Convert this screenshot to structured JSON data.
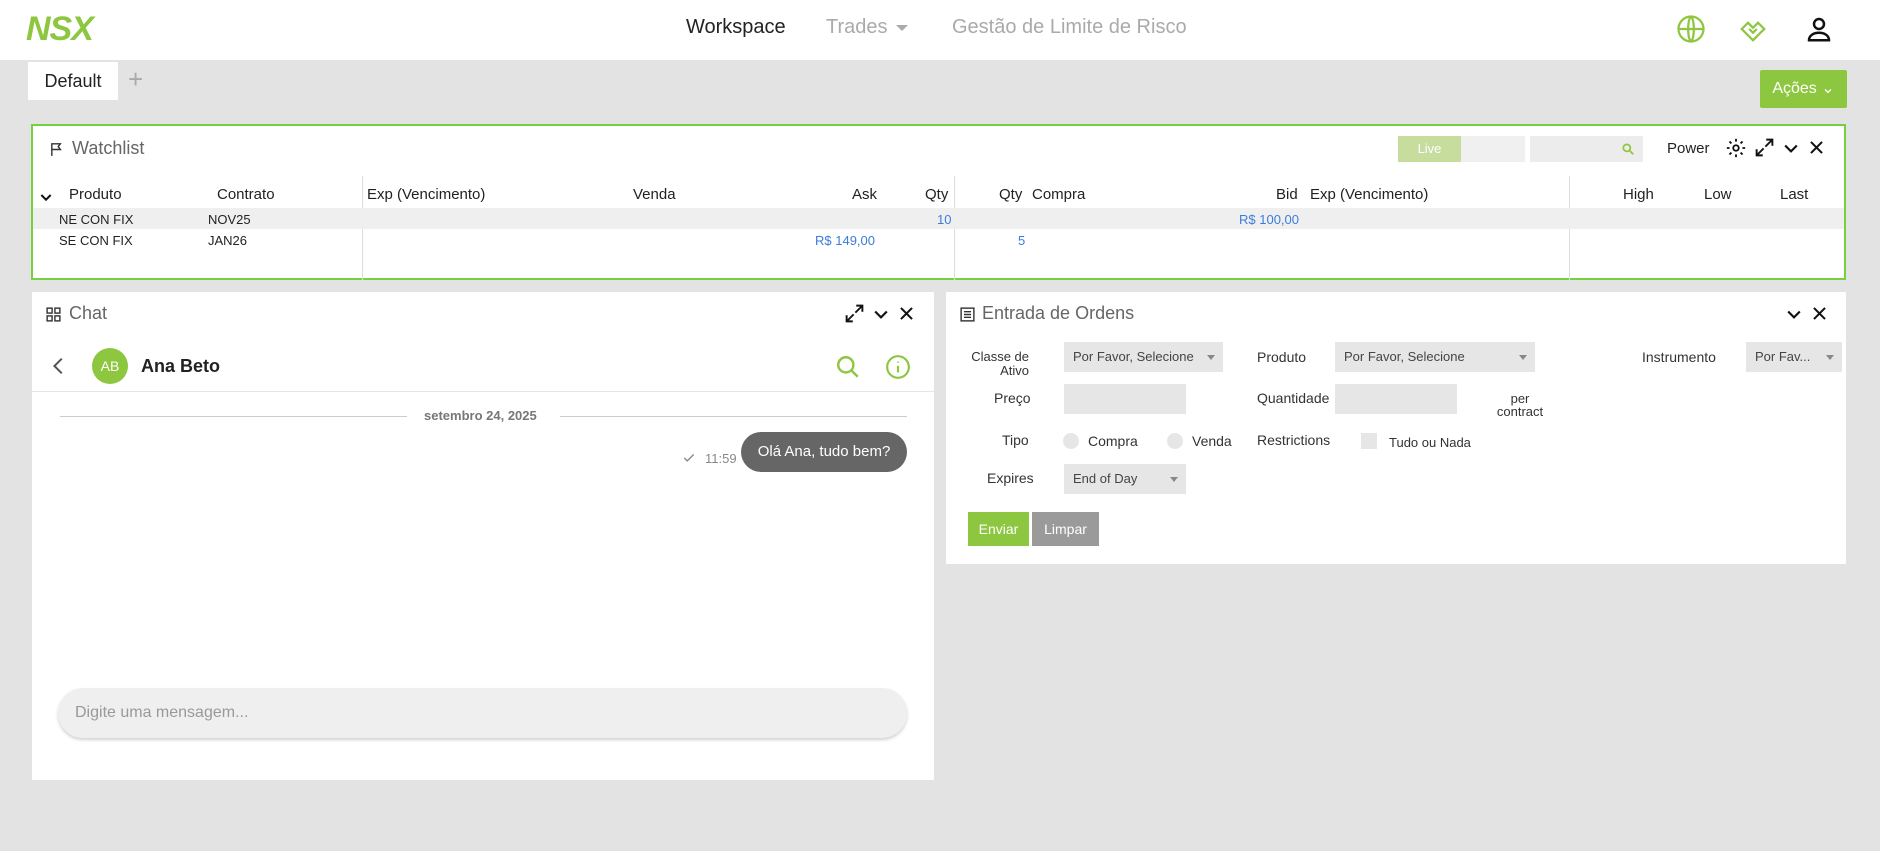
{
  "nav": {
    "logo": "NSX",
    "workspace": "Workspace",
    "trades": "Trades",
    "risk": "Gestão de Limite de Risco"
  },
  "tabs": {
    "default": "Default",
    "add": "+"
  },
  "actions_label": "Ações",
  "colors": {
    "accent": "#8dc63f",
    "panel_border": "#74d13f",
    "link_blue": "#3b7ddd"
  },
  "watchlist": {
    "title": "Watchlist",
    "live_label": "Live",
    "power_label": "Power",
    "headers": [
      "Produto",
      "Contrato",
      "Exp (Vencimento)",
      "Venda",
      "Ask",
      "Qty",
      "Qty",
      "Compra",
      "Bid",
      "Exp (Vencimento)",
      "High",
      "Low",
      "Last"
    ],
    "rows": [
      {
        "produto": "NE CON FIX",
        "contrato": "NOV25",
        "ask": "",
        "ask_qty": "10",
        "bid_qty": "",
        "bid": "R$ 100,00"
      },
      {
        "produto": "SE CON FIX",
        "contrato": "JAN26",
        "ask": "R$ 149,00",
        "ask_qty": "",
        "bid_qty": "5",
        "bid": ""
      }
    ]
  },
  "chat": {
    "title": "Chat",
    "contact_initials": "AB",
    "contact_name": "Ana Beto",
    "date_divider": "setembro 24, 2025",
    "message_time": "11:59",
    "message_text": "Olá Ana, tudo bem?",
    "input_placeholder": "Digite uma mensagem..."
  },
  "orders": {
    "title": "Entrada de Ordens",
    "asset_class_label_1": "Classe de",
    "asset_class_label_2": "Ativo",
    "asset_class_value": "Por Favor, Selecione",
    "product_label": "Produto",
    "product_value": "Por Favor, Selecione",
    "instrument_label": "Instrumento",
    "instrument_value": "Por Fav...",
    "price_label": "Preço",
    "qty_label": "Quantidade",
    "per_contract_1": "per",
    "per_contract_2": "contract",
    "type_label": "Tipo",
    "buy_label": "Compra",
    "sell_label": "Venda",
    "restrictions_label": "Restrictions",
    "all_or_none_label": "Tudo ou Nada",
    "expires_label": "Expires",
    "expires_value": "End of Day",
    "send_label": "Enviar",
    "clear_label": "Limpar"
  }
}
